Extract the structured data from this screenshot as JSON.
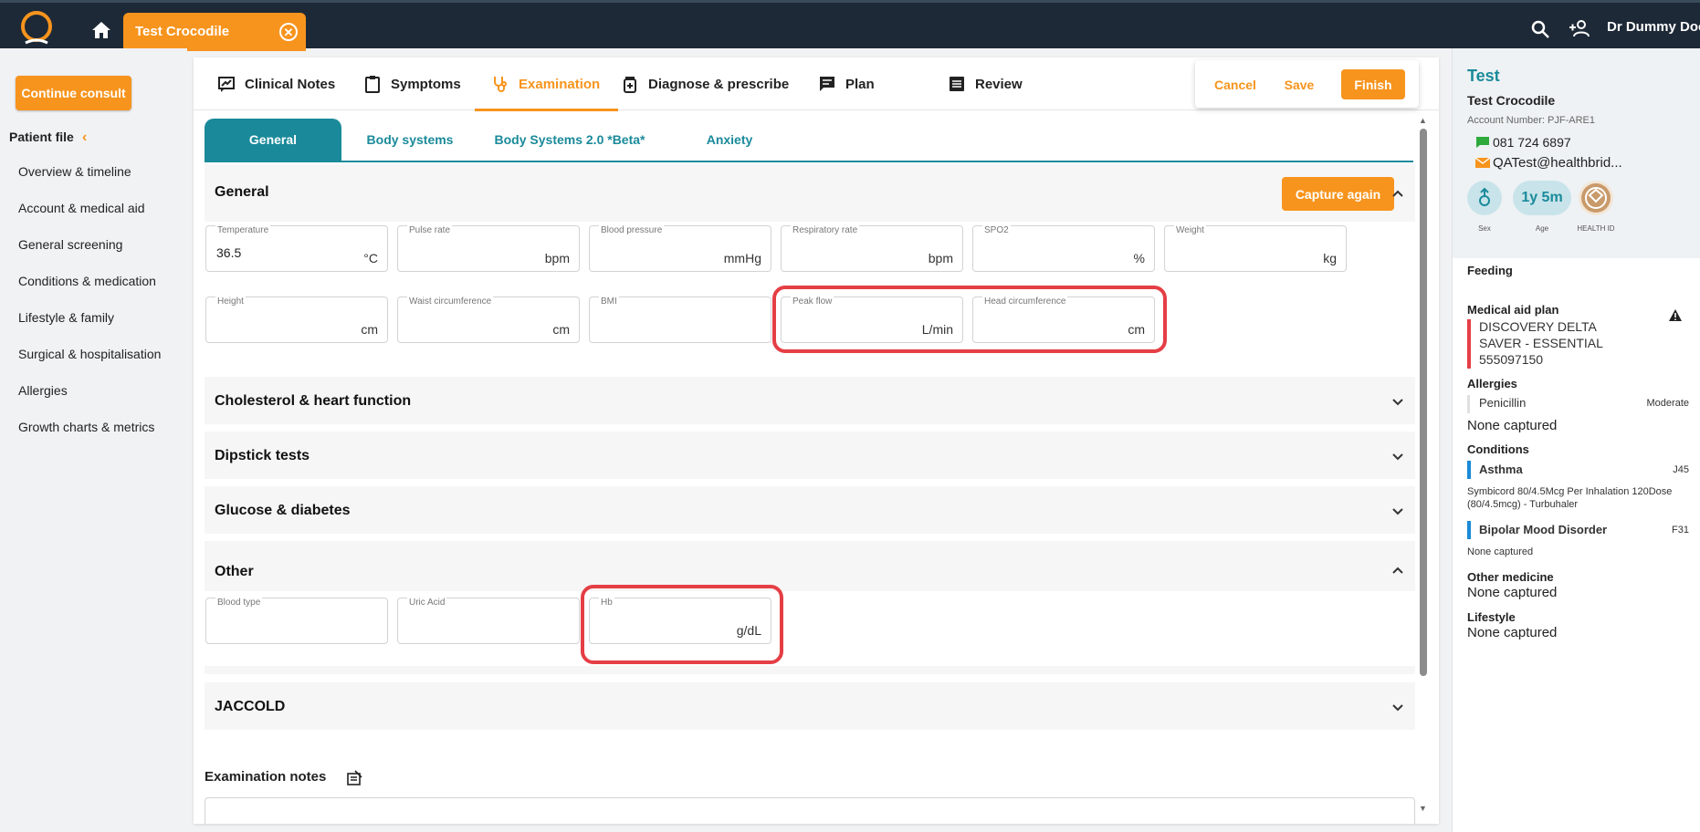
{
  "topbar": {
    "patient_tab": "Test Crocodile",
    "close_glyph": "✕",
    "user_name": "Dr Dummy Doc"
  },
  "left": {
    "continue_label": "Continue consult",
    "patient_file_title": "Patient file",
    "collapse_glyph": "‹",
    "nav": [
      "Overview & timeline",
      "Account & medical aid",
      "General screening",
      "Conditions & medication",
      "Lifestyle & family",
      "Surgical & hospitalisation",
      "Allergies",
      "Growth charts & metrics"
    ]
  },
  "main_tabs": [
    {
      "label": "Clinical Notes",
      "icon": "clinical-notes-icon"
    },
    {
      "label": "Symptoms",
      "icon": "clipboard-icon"
    },
    {
      "label": "Examination",
      "icon": "stethoscope-icon",
      "active": true
    },
    {
      "label": "Diagnose & prescribe",
      "icon": "medicine-icon"
    },
    {
      "label": "Plan",
      "icon": "chat-icon"
    },
    {
      "label": "Review",
      "icon": "list-icon"
    }
  ],
  "actions": {
    "cancel": "Cancel",
    "save": "Save",
    "finish": "Finish"
  },
  "sub_tabs": [
    "General",
    "Body systems",
    "Body Systems 2.0 *Beta*",
    "Anxiety"
  ],
  "general": {
    "title": "General",
    "capture_again": "Capture again",
    "fields": [
      {
        "label": "Temperature",
        "value": "36.5",
        "unit": "°C"
      },
      {
        "label": "Pulse rate",
        "value": "",
        "unit": "bpm"
      },
      {
        "label": "Blood pressure",
        "value": "",
        "unit": "mmHg"
      },
      {
        "label": "Respiratory rate",
        "value": "",
        "unit": "bpm"
      },
      {
        "label": "SPO2",
        "value": "",
        "unit": "%"
      },
      {
        "label": "Weight",
        "value": "",
        "unit": "kg"
      },
      {
        "label": "Height",
        "value": "",
        "unit": "cm"
      },
      {
        "label": "Waist circumference",
        "value": "",
        "unit": "cm"
      },
      {
        "label": "BMI",
        "value": "",
        "unit": ""
      },
      {
        "label": "Peak flow",
        "value": "",
        "unit": "L/min"
      },
      {
        "label": "Head circumference",
        "value": "",
        "unit": "cm"
      }
    ]
  },
  "sections": {
    "cholesterol": "Cholesterol & heart function",
    "dipstick": "Dipstick tests",
    "glucose": "Glucose & diabetes",
    "other": "Other",
    "jaccold": "JACCOLD"
  },
  "other_fields": [
    {
      "label": "Blood type",
      "value": "",
      "unit": ""
    },
    {
      "label": "Uric Acid",
      "value": "",
      "unit": ""
    },
    {
      "label": "Hb",
      "value": "",
      "unit": "g/dL"
    }
  ],
  "exam_notes_title": "Examination notes",
  "right": {
    "name": "Test",
    "full_name": "Test Crocodile",
    "account": "Account Number: PJF-ARE1",
    "phone": "081 724 6897",
    "email": "QATest@healthbrid...",
    "badges": {
      "sex_label": "Sex",
      "age": "1y 5m",
      "age_label": "Age",
      "health_label": "HEALTH ID"
    },
    "feeding_title": "Feeding",
    "medical_aid_title": "Medical aid plan",
    "medical_aid_lines": [
      "DISCOVERY DELTA",
      "SAVER - ESSENTIAL",
      "555097150"
    ],
    "allergies_title": "Allergies",
    "allergy": {
      "name": "Penicillin",
      "severity": "Moderate"
    },
    "allergies_none": "None captured",
    "conditions_title": "Conditions",
    "conditions": [
      {
        "name": "Asthma",
        "code": "J45",
        "detail_1": "Symbicord 80/4.5Mcg Per Inhalation 120Dose",
        "detail_2": "(80/4.5mcg) - Turbuhaler"
      },
      {
        "name": "Bipolar Mood Disorder",
        "code": "F31",
        "detail_1": "None captured",
        "detail_2": ""
      }
    ],
    "other_medicine_title": "Other medicine",
    "other_medicine_value": "None captured",
    "lifestyle_title": "Lifestyle",
    "lifestyle_value": "None captured"
  },
  "colors": {
    "brand_orange": "#f7941d",
    "teal": "#1a8a9a",
    "topbar": "#1e2937",
    "highlight_red": "#e53e45"
  }
}
